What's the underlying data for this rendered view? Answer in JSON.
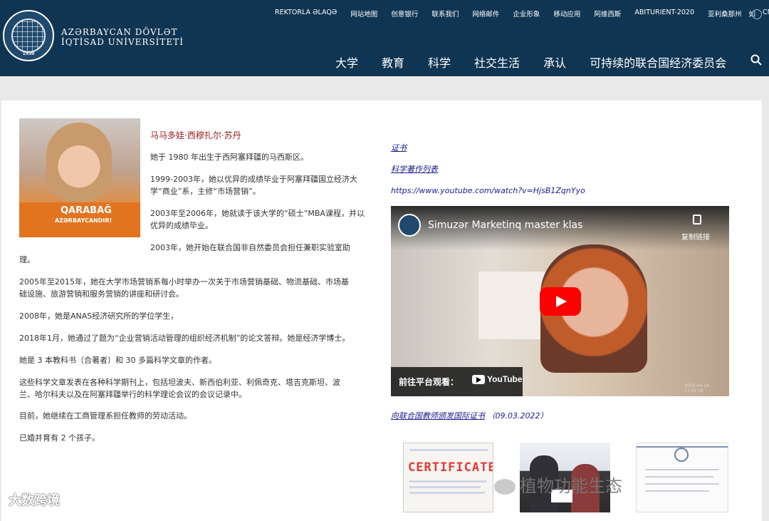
{
  "header": {
    "university_name_line1": "AZƏRBAYCAN DÖVLƏT",
    "university_name_line2": "İQTİSAD UNİVERSİTETİ",
    "logo_year": "1930",
    "top_links": [
      "REKTORLA ƏLAQƏ",
      "网站地图",
      "创意银行",
      "联系我们",
      "网络邮件",
      "企业形象",
      "移动应用",
      "阿维西斯",
      "ABITURIENT-2020",
      "亚利桑那州",
      "如",
      "CN"
    ],
    "main_nav": [
      "大学",
      "教育",
      "科学",
      "社交生活",
      "承认",
      "可持续的联合国经济委员会"
    ]
  },
  "bio": {
    "photo_text1": "QARABAĞ",
    "photo_text2": "AZƏRBAYCANDIR!",
    "name": "马马多娃·西穆扎尔·苏丹",
    "p1": "她于 1980 年出生于西阿塞拜疆的马西斯区。",
    "p2a": "1999-2003年，她以优异的成绩毕业于阿塞拜疆国立经济大",
    "p2b": "学“商业”系，主修“市场营销”。",
    "p3a": "2003年至2006年，她就读于该大学的“硕士”MBA课程，并以",
    "p3b": "优异的成绩毕业。",
    "p4a": "2003年，她开始在联合国非自然委员会担任兼职实验室助",
    "p4b": "理。",
    "p5a": "2005年至2015年，她在大学市场营销系每小时举办一次关于市场营销基础、物流基础、市场基",
    "p5b": "础设施、旅游营销和服务营销的讲座和研讨会。",
    "p6": "2008年，她是ANAS经济研究所的学位学生，",
    "p7": "2018年1月，她通过了题为“企业营销活动管理的组织经济机制”的论文答辩。她是经济学博士。",
    "p8": "她是 3 本教科书（合著者）和 30 多篇科学文章的作者。",
    "p9a": "这些科学文章发表在各种科学期刊上，包括坦波夫、新西伯利亚、利佩奇克、塔吉克斯坦、波",
    "p9b": "兰、哈尔科夫以及在阿塞拜疆举行的科学理论会议的会议记录中。",
    "p10": "目前，她继续在工商管理系担任教师的劳动活动。",
    "p11": "已婚并育有 2 个孩子。"
  },
  "side": {
    "link_certificate": "证书",
    "link_works": "科学著作列表",
    "youtube_url": "https://www.youtube.com/watch?v=HjsB1ZqnYyo",
    "video_title": "Simuzər Marketinq master klas",
    "copy_link": "复制链接",
    "watch_on": "前往平台观看：",
    "youtube_label": "YouTube",
    "video_stamp": "2022-04-14 17:01:34",
    "caption_link": "向联合国教师颁发国际证书",
    "caption_date": "（09.03.2022）",
    "certificate_word": "CERTIFICATE"
  },
  "watermarks": {
    "left": "大数跨境",
    "right": "植物功能生态"
  }
}
